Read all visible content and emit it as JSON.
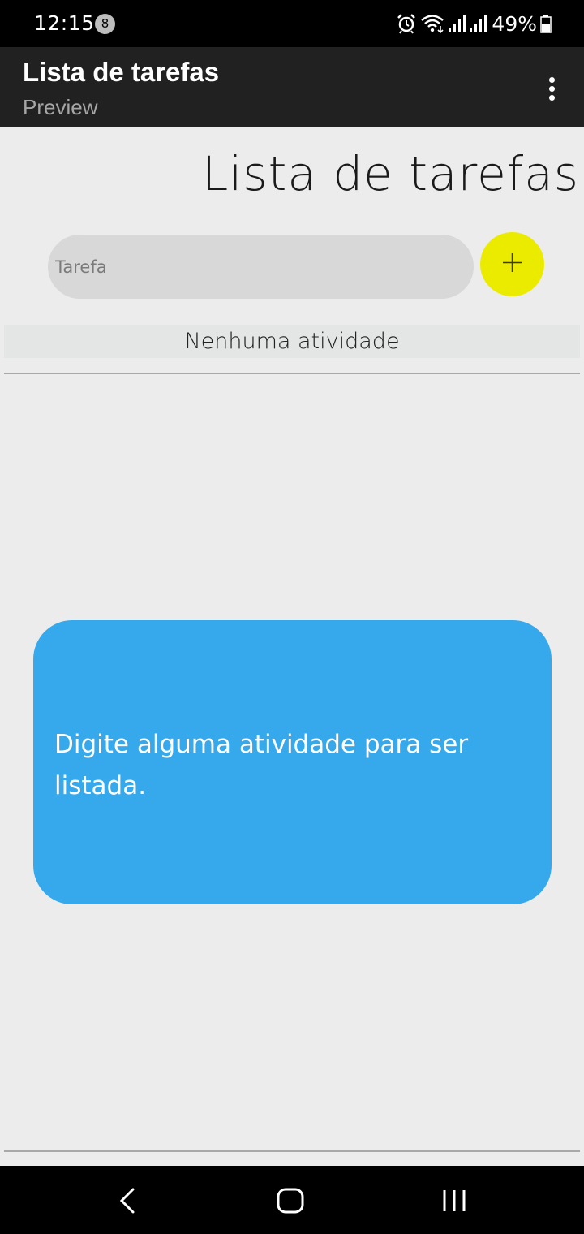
{
  "status_bar": {
    "time": "12:15",
    "notification_count": "8",
    "battery": "49%",
    "icons": [
      "alarm-icon",
      "wifi-icon",
      "signal-icon",
      "signal-icon",
      "battery-icon"
    ]
  },
  "app_bar": {
    "title": "Lista de tarefas",
    "subtitle": "Preview",
    "menu_icon": "more-vert-icon"
  },
  "main": {
    "heading": "Lista de tarefas",
    "task_input": {
      "placeholder": "Tarefa",
      "value": ""
    },
    "add_button_icon": "plus-icon",
    "list_header": "Nenhuma atividade",
    "items": []
  },
  "info_card": {
    "text": "Digite alguma atividade para ser listada."
  },
  "nav_bar": {
    "buttons": [
      "back-icon",
      "home-icon",
      "recents-icon"
    ]
  },
  "colors": {
    "accent_yellow": "#ebeb00",
    "card_blue": "#36a9ed",
    "app_bar": "#212121",
    "background": "#ececec"
  }
}
